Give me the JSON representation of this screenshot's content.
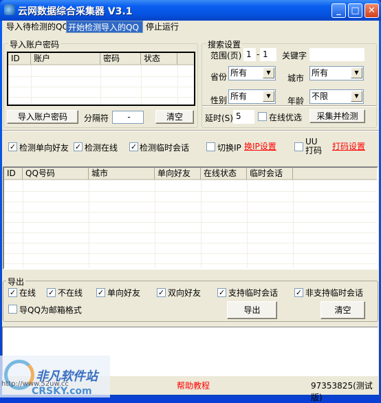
{
  "window": {
    "title": "云网数据综合采集器 V3.1",
    "minimize_icon": "minimize-icon",
    "maximize_icon": "maximize-icon",
    "close_icon": "close-icon"
  },
  "menu": [
    {
      "label": "导入待检测的QQ"
    },
    {
      "label": "开始检测导入的QQ",
      "selected": true
    },
    {
      "label": "停止运行"
    }
  ],
  "import_group": {
    "title": "导入账户密码",
    "columns": [
      "ID",
      "账户",
      "密码",
      "状态"
    ],
    "import_button": "导入账户密码",
    "separator_label": "分隔符",
    "separator_value": "-",
    "clear_button": "清空"
  },
  "search_group": {
    "title": "搜索设置",
    "range_label": "范围(页)",
    "range_from": "1",
    "range_dash": "-",
    "range_to": "1",
    "keyword_label": "关键字",
    "keyword_value": "",
    "province_label": "省份",
    "province_value": "所有",
    "city_label": "城市",
    "city_value": "所有",
    "gender_label": "性别",
    "gender_value": "所有",
    "age_label": "年龄",
    "age_value": "不限",
    "delay_label": "延时(S)",
    "delay_value": "5",
    "online_first_label": "在线优选",
    "online_first_checked": false,
    "collect_button": "采集并检测"
  },
  "options": {
    "check_oneway": {
      "label": "检测单向好友",
      "checked": true
    },
    "check_online": {
      "label": "检测在线",
      "checked": true
    },
    "check_temp": {
      "label": "检测临时会话",
      "checked": true
    },
    "switch_ip": {
      "label": "切换IP",
      "checked": false
    },
    "ip_settings_link": "换IP设置",
    "uu": {
      "label": "UU打码",
      "checked": false
    },
    "captcha_settings_link": "打码设置"
  },
  "results": {
    "columns": [
      "ID",
      "QQ号码",
      "城市",
      "单向好友",
      "在线状态",
      "临时会话"
    ]
  },
  "export_group": {
    "title": "导出",
    "filters": [
      {
        "label": "在线",
        "checked": true
      },
      {
        "label": "不在线",
        "checked": true
      },
      {
        "label": "单向好友",
        "checked": true
      },
      {
        "label": "双向好友",
        "checked": true
      },
      {
        "label": "支持临时会话",
        "checked": true
      },
      {
        "label": "非支持临时会话",
        "checked": true
      }
    ],
    "email_format": {
      "label": "导QQ为邮箱格式",
      "checked": false
    },
    "export_button": "导出",
    "clear_button": "清空"
  },
  "status": {
    "help_link": "帮助教程",
    "version": "97353825(测试版)"
  },
  "watermark": {
    "text": "非凡软件站",
    "url": "http://www.52uw.cc",
    "brand": "CRSKY.com"
  },
  "colors": {
    "title_bar": "#0a5ff0",
    "menu_highlight": "#316ac5",
    "link": "#ff0000"
  }
}
